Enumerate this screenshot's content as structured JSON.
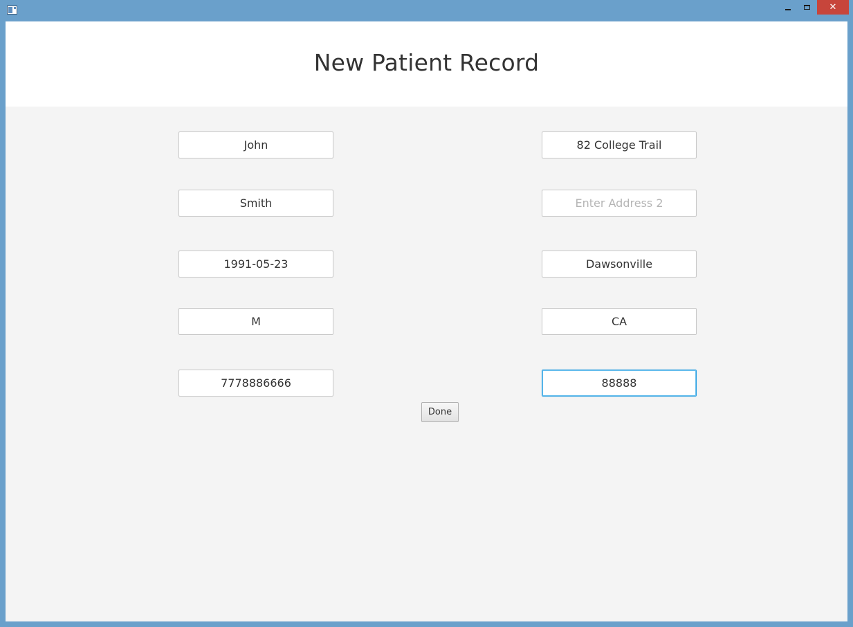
{
  "window": {
    "icon": "app-window-icon",
    "controls": {
      "minimize_icon": "minimize-icon",
      "maximize_icon": "maximize-icon",
      "close_label": "✕"
    }
  },
  "header": {
    "title": "New Patient Record"
  },
  "form": {
    "left": [
      {
        "name": "first-name-field",
        "value": "John",
        "placeholder": ""
      },
      {
        "name": "last-name-field",
        "value": "Smith",
        "placeholder": ""
      },
      {
        "name": "birth-date-field",
        "value": "1991-05-23",
        "placeholder": ""
      },
      {
        "name": "sex-field",
        "value": "M",
        "placeholder": ""
      },
      {
        "name": "phone-field",
        "value": "7778886666",
        "placeholder": ""
      }
    ],
    "right": [
      {
        "name": "address1-field",
        "value": "82 College Trail",
        "placeholder": ""
      },
      {
        "name": "address2-field",
        "value": "",
        "placeholder": "Enter Address 2"
      },
      {
        "name": "city-field",
        "value": "Dawsonville",
        "placeholder": ""
      },
      {
        "name": "state-field",
        "value": "CA",
        "placeholder": ""
      },
      {
        "name": "zip-field",
        "value": "88888",
        "placeholder": "",
        "focused": true
      }
    ],
    "done_label": "Done"
  },
  "colors": {
    "frame": "#6aa0cb",
    "close": "#c7453b",
    "focus": "#1e9ae0",
    "background": "#f4f4f4"
  }
}
